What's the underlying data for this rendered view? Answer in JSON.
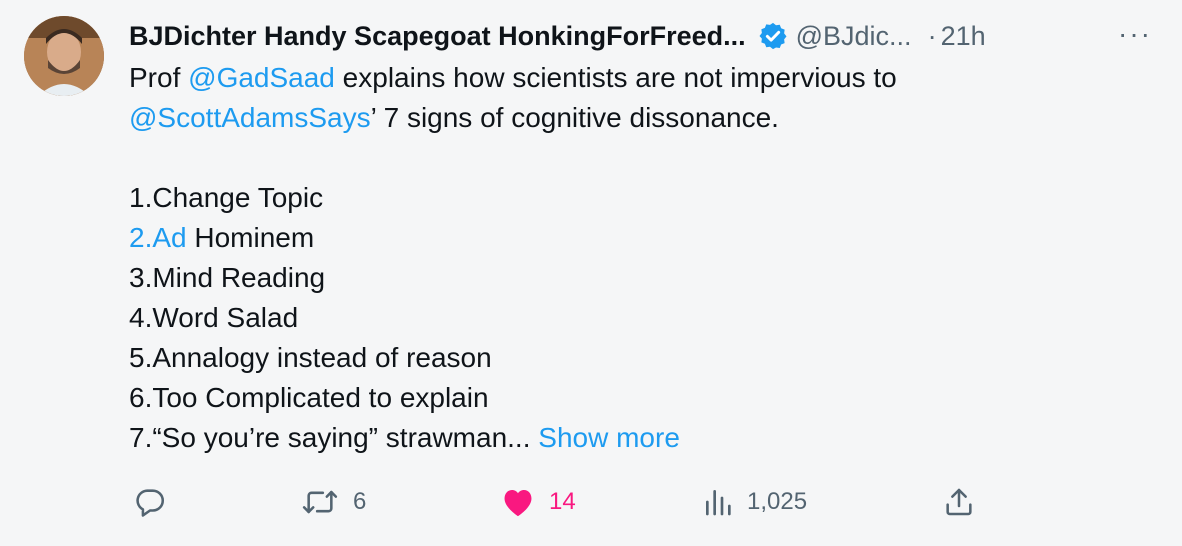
{
  "author": {
    "name": "BJDichter Handy Scapegoat HonkingForFreed...",
    "handle": "@BJdic...",
    "dot": "·",
    "time": "21h"
  },
  "more_icon": "···",
  "tweet": {
    "line1": {
      "prefix": "Prof ",
      "mention": "@GadSaad",
      "suffix": " explains how scientists are not impervious to"
    },
    "line2": {
      "mention": "@ScottAdamsSays",
      "suffix": "’ 7 signs of cognitive dissonance."
    },
    "list": {
      "item1": "1.Change Topic",
      "item2_link": "2.Ad",
      "item2_rest": " Hominem",
      "item3": "3.Mind Reading",
      "item4": "4.Word Salad",
      "item5": "5.Annalogy instead of reason",
      "item6": "6.Too Complicated to explain",
      "item7": "7.“So you’re saying” strawman... "
    },
    "show_more": "Show more"
  },
  "stats": {
    "replies": "",
    "retweets": "6",
    "likes": "14",
    "views": "1,025"
  },
  "colors": {
    "accent": "#1d9bf0",
    "like": "#f91880",
    "muted": "#536471",
    "text": "#0f1419",
    "background": "#f5f6f7"
  },
  "icons": [
    "avatar",
    "verified-badge-icon",
    "more-icon",
    "reply-icon",
    "retweet-icon",
    "heart-icon",
    "views-icon",
    "share-icon"
  ]
}
